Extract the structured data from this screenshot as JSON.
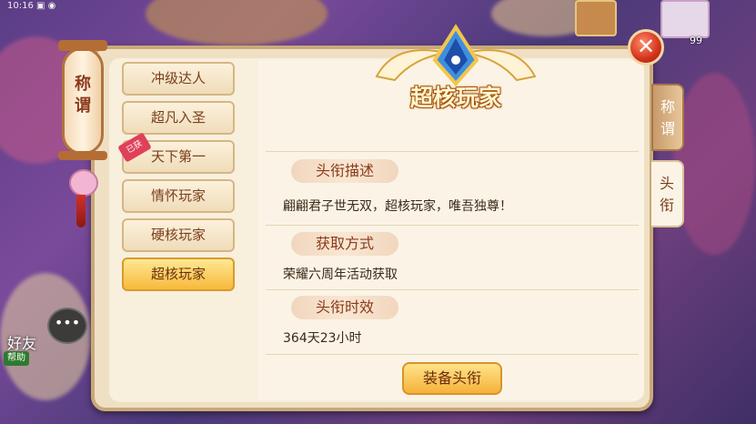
{
  "lantern": {
    "label": "称\n谓"
  },
  "emblem": {
    "title": "超核玩家"
  },
  "title_list": [
    {
      "label": "冲级达人",
      "selected": false,
      "badge": ""
    },
    {
      "label": "超凡入圣",
      "selected": false,
      "badge": ""
    },
    {
      "label": "天下第一",
      "selected": false,
      "badge": "已获"
    },
    {
      "label": "情怀玩家",
      "selected": false,
      "badge": ""
    },
    {
      "label": "硬核玩家",
      "selected": false,
      "badge": ""
    },
    {
      "label": "超核玩家",
      "selected": true,
      "badge": ""
    }
  ],
  "side_tabs": [
    {
      "label": "称\n谓"
    },
    {
      "label": "头\n衔"
    }
  ],
  "sections": {
    "desc_head": "头衔描述",
    "desc_text": "翩翩君子世无双，超核玩家，唯吾独尊！",
    "method_head": "获取方式",
    "method_text": "荣耀六周年活动获取",
    "time_head": "头衔时效",
    "time_text": "364天23小时"
  },
  "equip_button": "装备头衔",
  "hud": {
    "level": "99",
    "friend_label": "好友",
    "help_tag": "帮助"
  }
}
